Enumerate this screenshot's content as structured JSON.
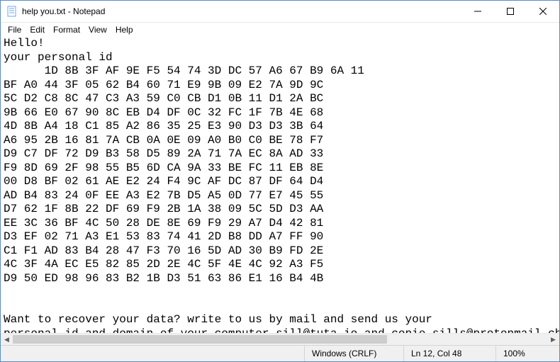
{
  "title": "help you.txt - Notepad",
  "menu": {
    "file": "File",
    "edit": "Edit",
    "format": "Format",
    "view": "View",
    "help": "Help"
  },
  "content": {
    "lines": [
      "Hello!",
      "your personal id",
      "      1D 8B 3F AF 9E F5 54 74 3D DC 57 A6 67 B9 6A 11",
      "BF A0 44 3F 05 62 B4 60 71 E9 9B 09 E2 7A 9D 9C",
      "5C D2 C8 8C 47 C3 A3 59 C0 CB D1 0B 11 D1 2A BC",
      "9B 66 E0 67 90 8C EB D4 DF 0C 32 FC 1F 7B 4E 68",
      "4D 8B A4 18 C1 85 A2 86 35 25 E3 90 D3 D3 3B 64",
      "A6 95 2B 16 81 7A CB 0A 0E 09 A0 B0 C0 BE 78 F7",
      "D9 C7 DF 72 D9 B3 58 D5 89 2A 71 7A EC 8A AD 33",
      "F9 8D 69 2F 98 55 B5 6D CA 9A 33 BE FC 11 EB 8E",
      "00 D8 BF 02 61 AE E2 24 F4 9C AF DC 87 DF 64 D4",
      "AD B4 83 24 0F EE A3 E2 7B D5 A5 0D 77 E7 45 55",
      "D7 62 1F 8B 22 DF 69 F9 2B 1A 38 09 5C 5D D3 AA",
      "EE 3C 36 BF 4C 50 28 DE 8E 69 F9 29 A7 D4 42 81",
      "D3 EF 02 71 A3 E1 53 83 74 41 2D B8 DD A7 FF 90",
      "C1 F1 AD 83 B4 28 47 F3 70 16 5D AD 30 B9 FD 2E",
      "4C 3F 4A EC E5 82 85 2D 2E 4C 5F 4E 4C 92 A3 F5",
      "D9 50 ED 98 96 83 B2 1B D3 51 63 86 E1 16 B4 4B",
      "",
      "",
      "Want to recover your data? write to us by mail and send us your",
      "personal id and domain of your computer sill@tuta.io and copie sills@protonmail.ch"
    ]
  },
  "status": {
    "encoding": "Windows (CRLF)",
    "position": "Ln 12, Col 48",
    "zoom": "100%"
  }
}
